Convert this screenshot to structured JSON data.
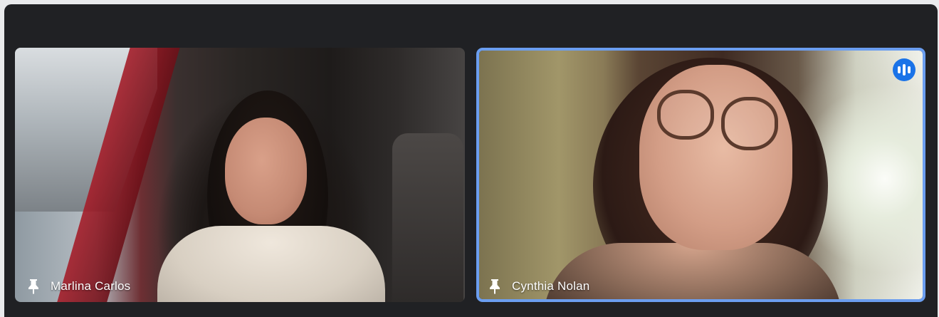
{
  "participants": [
    {
      "name": "Marlina Carlos",
      "pin_icon": "pin-icon",
      "is_active_speaker": false
    },
    {
      "name": "Cynthia Nolan",
      "pin_icon": "pin-icon",
      "is_active_speaker": true,
      "speaker_icon": "audio-level-icon"
    }
  ],
  "colors": {
    "window_bg": "#202124",
    "active_speaker_border": "#6b9ef0",
    "speaking_badge": "#1a73e8",
    "name_text": "#ffffff"
  }
}
